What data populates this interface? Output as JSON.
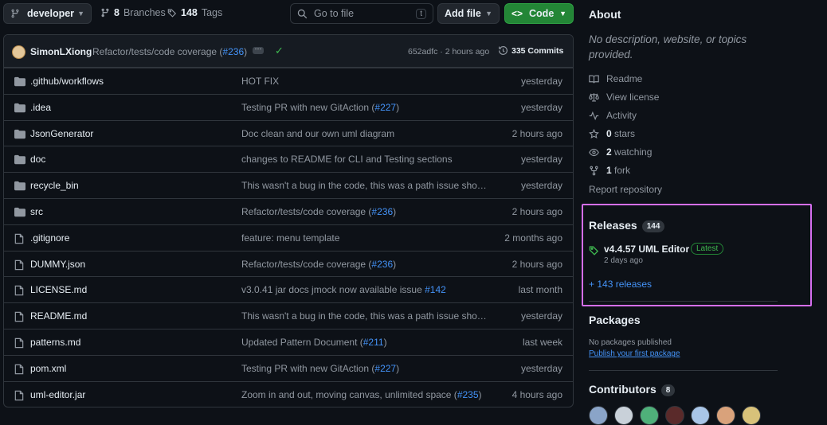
{
  "toolbar": {
    "branch": "developer",
    "branches_count": "8",
    "branches_label": "Branches",
    "tags_count": "148",
    "tags_label": "Tags",
    "search_placeholder": "Go to file",
    "search_shortcut": "t",
    "add_file": "Add file",
    "code": "Code"
  },
  "commit": {
    "author": "SimonLXiong",
    "message_prefix": "Refactor/tests/code coverage (",
    "pr": "#236",
    "message_suffix": ")",
    "hash_time": "652adfc · 2 hours ago",
    "commits_count": "335 Commits"
  },
  "files": [
    {
      "name": ".github/workflows",
      "type": "dir",
      "msg": "HOT FIX",
      "pr": "",
      "tail": "",
      "time": "yesterday"
    },
    {
      "name": ".idea",
      "type": "dir",
      "msg": "Testing PR with new GitAction (",
      "pr": "#227",
      "tail": ")",
      "time": "yesterday"
    },
    {
      "name": "JsonGenerator",
      "type": "dir",
      "msg": "Doc clean and our own uml diagram",
      "pr": "",
      "tail": "",
      "time": "2 hours ago"
    },
    {
      "name": "doc",
      "type": "dir",
      "msg": "changes to README for CLI and Testing sections",
      "pr": "",
      "tail": "",
      "time": "yesterday"
    },
    {
      "name": "recycle_bin",
      "type": "dir",
      "msg": "This wasn't a bug in the code, this was a path issue shoul...",
      "pr": "",
      "tail": "",
      "time": "yesterday"
    },
    {
      "name": "src",
      "type": "dir",
      "msg": "Refactor/tests/code coverage (",
      "pr": "#236",
      "tail": ")",
      "time": "2 hours ago"
    },
    {
      "name": ".gitignore",
      "type": "file",
      "msg": "feature: menu template",
      "pr": "",
      "tail": "",
      "time": "2 months ago"
    },
    {
      "name": "DUMMY.json",
      "type": "file",
      "msg": "Refactor/tests/code coverage (",
      "pr": "#236",
      "tail": ")",
      "time": "2 hours ago"
    },
    {
      "name": "LICENSE.md",
      "type": "file",
      "msg": "v3.0.41 jar docs jmock now available issue ",
      "pr": "#142",
      "tail": "",
      "time": "last month"
    },
    {
      "name": "README.md",
      "type": "file",
      "msg": "This wasn't a bug in the code, this was a path issue shoul...",
      "pr": "",
      "tail": "",
      "time": "yesterday"
    },
    {
      "name": "patterns.md",
      "type": "file",
      "msg": "Updated Pattern Document (",
      "pr": "#211",
      "tail": ")",
      "time": "last week"
    },
    {
      "name": "pom.xml",
      "type": "file",
      "msg": "Testing PR with new GitAction (",
      "pr": "#227",
      "tail": ")",
      "time": "yesterday"
    },
    {
      "name": "uml-editor.jar",
      "type": "file",
      "msg": "Zoom in and out, moving canvas, unlimited space (",
      "pr": "#235",
      "tail": ")",
      "time": "4 hours ago"
    }
  ],
  "about": {
    "title": "About",
    "description": "No description, website, or topics provided.",
    "readme": "Readme",
    "license": "View license",
    "activity": "Activity",
    "stars_count": "0",
    "stars_label": "stars",
    "watching_count": "2",
    "watching_label": "watching",
    "fork_count": "1",
    "fork_label": "fork",
    "report": "Report repository"
  },
  "releases": {
    "title": "Releases",
    "count": "144",
    "latest_name": "v4.4.57 UML Editor",
    "latest_badge": "Latest",
    "latest_time": "2 days ago",
    "more": "+ 143 releases",
    "highlight_color": "#d56ef0"
  },
  "packages": {
    "title": "Packages",
    "none": "No packages published",
    "publish": "Publish your first package"
  },
  "contributors": {
    "title": "Contributors",
    "count": "8"
  },
  "colors": {
    "bg": "#0d1117",
    "link": "#4493f8",
    "code_button": "#238636",
    "success": "#3fb950"
  }
}
